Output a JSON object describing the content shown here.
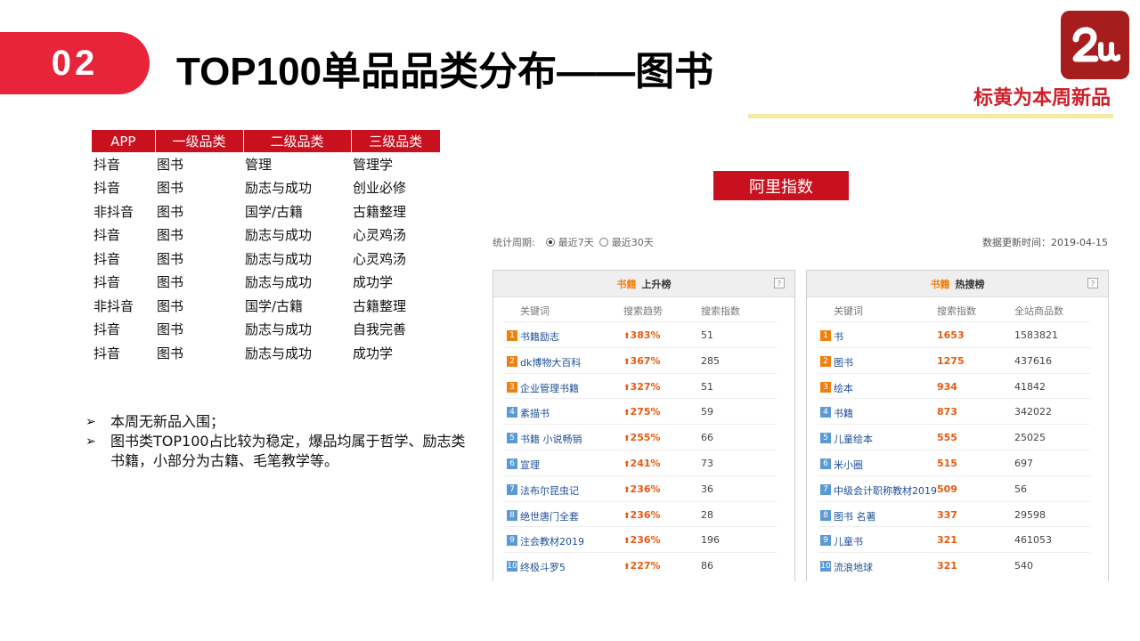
{
  "header": {
    "number": "02",
    "title": "TOP100单品品类分布——图书",
    "note": "标黄为本周新品",
    "logo_text": "2u"
  },
  "category_table": {
    "headers": [
      "APP",
      "一级品类",
      "二级品类",
      "三级品类"
    ],
    "rows": [
      [
        "抖音",
        "图书",
        "管理",
        "管理学"
      ],
      [
        "抖音",
        "图书",
        "励志与成功",
        "创业必修"
      ],
      [
        "非抖音",
        "图书",
        "国学/古籍",
        "古籍整理"
      ],
      [
        "抖音",
        "图书",
        "励志与成功",
        "心灵鸡汤"
      ],
      [
        "抖音",
        "图书",
        "励志与成功",
        "心灵鸡汤"
      ],
      [
        "抖音",
        "图书",
        "励志与成功",
        "成功学"
      ],
      [
        "非抖音",
        "图书",
        "国学/古籍",
        "古籍整理"
      ],
      [
        "抖音",
        "图书",
        "励志与成功",
        "自我完善"
      ],
      [
        "抖音",
        "图书",
        "励志与成功",
        "成功学"
      ]
    ]
  },
  "bullets": [
    "本周无新品入围；",
    "图书类TOP100占比较为稳定，爆品均属于哲学、励志类书籍，小部分为古籍、毛笔教学等。"
  ],
  "ali_index": {
    "label": "阿里指数",
    "period_label": "统计周期:",
    "period_options": [
      {
        "label": "最近7天",
        "selected": true
      },
      {
        "label": "最近30天",
        "selected": false
      }
    ],
    "updated": "数据更新时间：2019-04-15",
    "rising": {
      "category": "书籍",
      "title": "上升榜",
      "help": "?",
      "columns": [
        "关键词",
        "搜索趋势",
        "搜索指数"
      ],
      "rows": [
        {
          "rank": "1",
          "keyword": "书籍励志",
          "trend": "383%",
          "index": "51"
        },
        {
          "rank": "2",
          "keyword": "dk博物大百科",
          "trend": "367%",
          "index": "285"
        },
        {
          "rank": "3",
          "keyword": "企业管理书籍",
          "trend": "327%",
          "index": "51"
        },
        {
          "rank": "4",
          "keyword": "素描书",
          "trend": "275%",
          "index": "59"
        },
        {
          "rank": "5",
          "keyword": "书籍 小说畅销",
          "trend": "255%",
          "index": "66"
        },
        {
          "rank": "6",
          "keyword": "宣理",
          "trend": "241%",
          "index": "73"
        },
        {
          "rank": "7",
          "keyword": "法布尔昆虫记",
          "trend": "236%",
          "index": "36"
        },
        {
          "rank": "8",
          "keyword": "绝世唐门全套",
          "trend": "236%",
          "index": "28"
        },
        {
          "rank": "9",
          "keyword": "注会教材2019",
          "trend": "236%",
          "index": "196"
        },
        {
          "rank": "10",
          "keyword": "终极斗罗5",
          "trend": "227%",
          "index": "86"
        }
      ]
    },
    "hot": {
      "category": "书籍",
      "title": "热搜榜",
      "help": "?",
      "columns": [
        "关键词",
        "搜索指数",
        "全站商品数"
      ],
      "rows": [
        {
          "rank": "1",
          "keyword": "书",
          "index": "1653",
          "count": "1583821"
        },
        {
          "rank": "2",
          "keyword": "图书",
          "index": "1275",
          "count": "437616"
        },
        {
          "rank": "3",
          "keyword": "绘本",
          "index": "934",
          "count": "41842"
        },
        {
          "rank": "4",
          "keyword": "书籍",
          "index": "873",
          "count": "342022"
        },
        {
          "rank": "5",
          "keyword": "儿童绘本",
          "index": "555",
          "count": "25025"
        },
        {
          "rank": "6",
          "keyword": "米小圈",
          "index": "515",
          "count": "697"
        },
        {
          "rank": "7",
          "keyword": "中级会计职称教材2019",
          "index": "509",
          "count": "56"
        },
        {
          "rank": "8",
          "keyword": "图书 名著",
          "index": "337",
          "count": "29598"
        },
        {
          "rank": "9",
          "keyword": "儿童书",
          "index": "321",
          "count": "461053"
        },
        {
          "rank": "10",
          "keyword": "流浪地球",
          "index": "321",
          "count": "540"
        }
      ]
    }
  },
  "colors": {
    "accent_red": "#e8243a",
    "table_header_red": "#c8101f",
    "logo_bg": "#a71d1d",
    "note_red": "#d0202a",
    "highlight_bar": "#f5e7a4",
    "trend_orange": "#e85a10",
    "keyword_blue": "#1f4e99",
    "rank_top": "#f08010",
    "rank_normal": "#5b9bd5"
  }
}
